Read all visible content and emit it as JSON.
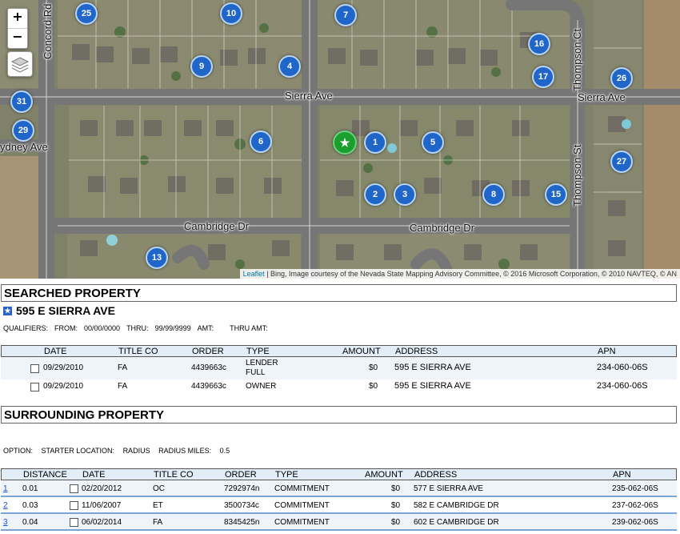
{
  "map": {
    "zoom_in": "+",
    "zoom_out": "−",
    "attribution_prefix": "Leaflet",
    "attribution_text": " | Bing, Image courtesy of the Nevada State Mapping Advisory Committee, © 2016 Microsoft Corporation, © 2010 NAVTEQ, © AN",
    "home_marker": "★",
    "markers": [
      "25",
      "10",
      "7",
      "16",
      "9",
      "4",
      "17",
      "26",
      "31",
      "29",
      "6",
      "1",
      "5",
      "27",
      "2",
      "3",
      "8",
      "15",
      "13"
    ],
    "streets": {
      "sierra_ave_1": "Sierra Ave",
      "sierra_ave_2": "Sierra Ave",
      "cambridge_dr_1": "Cambridge Dr",
      "cambridge_dr_2": "Cambridge Dr",
      "sydney_ave": "ydney Ave",
      "concord_rd": "Concord Rd",
      "thompson_ct": "Thompson Ct",
      "thompson_st": "Thompson St"
    }
  },
  "searched": {
    "title": "SEARCHED PROPERTY",
    "address_heading": "595 E SIERRA AVE",
    "qualifiers": {
      "label": "QUALIFIERS:",
      "from_label": "FROM:",
      "from": "00/00/0000",
      "thru_label": "THRU:",
      "thru": "99/99/9999",
      "amt_label": "AMT:",
      "thru_amt_label": "THRU AMT:"
    },
    "columns": [
      "DATE",
      "TITLE CO",
      "ORDER",
      "TYPE",
      "AMOUNT",
      "ADDRESS",
      "APN"
    ],
    "rows": [
      {
        "date": "09/29/2010",
        "title_co": "FA",
        "order": "4439663c",
        "type_1": "LENDER",
        "type_2": "FULL",
        "amount": "$0",
        "address": "595 E SIERRA AVE",
        "apn": "234-060-06S"
      },
      {
        "date": "09/29/2010",
        "title_co": "FA",
        "order": "4439663c",
        "type_1": "OWNER",
        "type_2": "",
        "amount": "$0",
        "address": "595 E SIERRA AVE",
        "apn": "234-060-06S"
      }
    ]
  },
  "surrounding": {
    "title": "SURROUNDING PROPERTY",
    "option": {
      "label": "OPTION:",
      "start_label": "STARTER LOCATION:",
      "start": "RADIUS",
      "miles_label": "RADIUS MILES:",
      "miles": "0.5"
    },
    "columns": [
      "DISTANCE",
      "DATE",
      "TITLE CO",
      "ORDER",
      "TYPE",
      "AMOUNT",
      "ADDRESS",
      "APN"
    ],
    "rows": [
      {
        "idx": "1",
        "distance": "0.01",
        "date": "02/20/2012",
        "title_co": "OC",
        "order": "7292974n",
        "type": "COMMITMENT",
        "amount": "$0",
        "address": "577 E SIERRA AVE",
        "apn": "235-062-06S"
      },
      {
        "idx": "2",
        "distance": "0.03",
        "date": "11/06/2007",
        "title_co": "ET",
        "order": "3500734c",
        "type": "COMMITMENT",
        "amount": "$0",
        "address": "582 E CAMBRIDGE DR",
        "apn": "237-062-06S"
      },
      {
        "idx": "3",
        "distance": "0.04",
        "date": "06/02/2014",
        "title_co": "FA",
        "order": "8345425n",
        "type": "COMMITMENT",
        "amount": "$0",
        "address": "602 E CAMBRIDGE DR",
        "apn": "239-062-06S"
      }
    ]
  },
  "colors": {
    "marker": "#2066c9",
    "home_marker": "#1a9f2e",
    "header_bg": "#e3edf7",
    "row_rule": "#7aa3d6"
  }
}
